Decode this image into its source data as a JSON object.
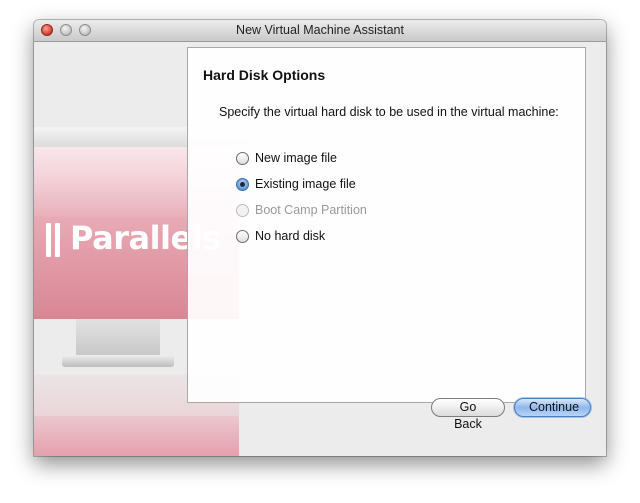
{
  "window": {
    "title": "New Virtual Machine Assistant"
  },
  "illustration": {
    "logo_text": "Parallels"
  },
  "panel": {
    "title": "Hard Disk Options",
    "description": "Specify the virtual hard disk to be used in the virtual machine:",
    "options": [
      {
        "label": "New image file",
        "selected": false,
        "enabled": true
      },
      {
        "label": "Existing image file",
        "selected": true,
        "enabled": true
      },
      {
        "label": "Boot Camp Partition",
        "selected": false,
        "enabled": false
      },
      {
        "label": "No hard disk",
        "selected": false,
        "enabled": true
      }
    ]
  },
  "buttons": {
    "back_label": "Go Back",
    "continue_label": "Continue"
  },
  "colors": {
    "accent": "#6f9fd8",
    "brand_pink": "#e7a7b3"
  }
}
